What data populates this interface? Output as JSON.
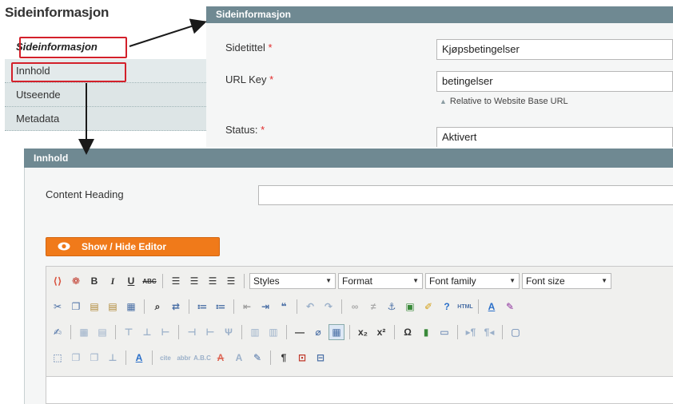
{
  "sidebar": {
    "title": "Sideinformasjon",
    "tabs": [
      {
        "label": "Sideinformasjon"
      },
      {
        "label": "Innhold"
      },
      {
        "label": "Utseende"
      },
      {
        "label": "Metadata"
      }
    ]
  },
  "info_panel": {
    "header": "Sideinformasjon",
    "fields": {
      "title": {
        "label": "Sidetittel",
        "value": "Kjøpsbetingelser"
      },
      "url_key": {
        "label": "URL Key",
        "value": "betingelser",
        "hint": "Relative to Website Base URL"
      },
      "status": {
        "label": "Status:",
        "value": "Aktivert"
      }
    },
    "required_mark": "*"
  },
  "content_panel": {
    "header": "Innhold",
    "heading_label": "Content Heading",
    "heading_value": "",
    "editor_toggle": "Show / Hide Editor"
  },
  "toolbar": {
    "styles": "Styles",
    "format": "Format",
    "font_family": "Font family",
    "font_size": "Font size"
  },
  "colors": {
    "panel_header": "#6f8992",
    "accent_orange": "#f07a1a",
    "highlight_red": "#d3202a",
    "required_red": "#e22b2b"
  }
}
